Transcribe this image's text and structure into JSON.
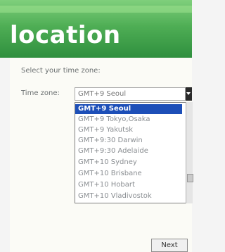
{
  "page": {
    "title": "location",
    "prompt": "Select your time zone:",
    "timezone_label": "Time zone:",
    "timezone_value": "GMT+9 Seoul"
  },
  "dropdown": {
    "options": [
      "GMT+9 Seoul",
      "GMT+9 Tokyo,Osaka",
      "GMT+9 Yakutsk",
      "GMT+9:30 Darwin",
      "GMT+9:30 Adelaide",
      "GMT+10 Sydney",
      "GMT+10 Brisbane",
      "GMT+10 Hobart",
      "GMT+10 Vladivostok"
    ],
    "selected_index": 0
  },
  "buttons": {
    "next": "Next"
  },
  "colors": {
    "header": "#4fae55",
    "selection": "#1d4fb8"
  }
}
